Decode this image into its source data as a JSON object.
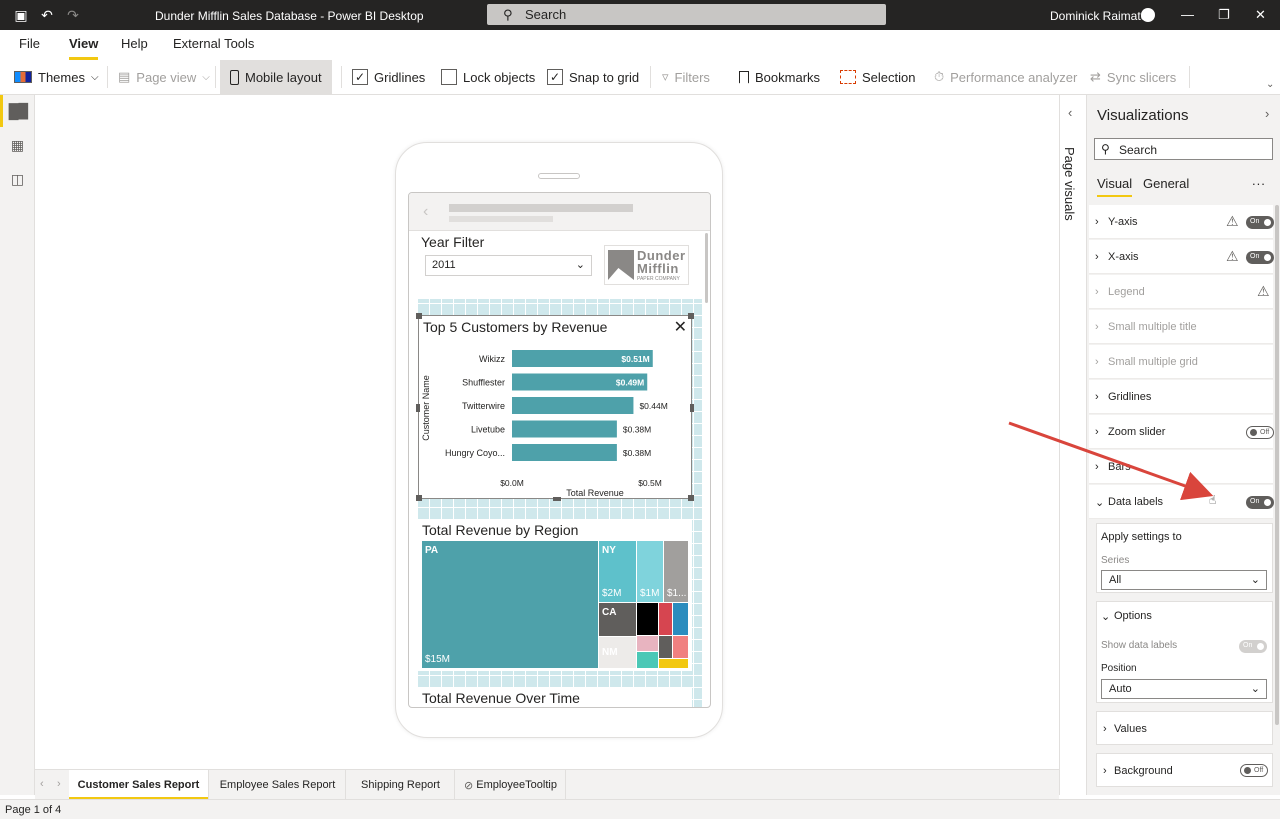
{
  "window": {
    "title": "Dunder Mifflin Sales Database - Power BI Desktop",
    "search_placeholder": "Search",
    "user": "Dominick Raimato"
  },
  "menu": [
    "File",
    "View",
    "Help",
    "External Tools"
  ],
  "ribbon": {
    "themes": "Themes",
    "page_view": "Page view",
    "mobile_layout": "Mobile layout",
    "gridlines": "Gridlines",
    "lock_objects": "Lock objects",
    "snap_to_grid": "Snap to grid",
    "filters": "Filters",
    "bookmarks": "Bookmarks",
    "selection": "Selection",
    "performance_analyzer": "Performance analyzer",
    "sync_slicers": "Sync slicers"
  },
  "mobile": {
    "year_filter": {
      "title": "Year Filter",
      "value": "2011"
    },
    "logo": {
      "line1": "Dunder",
      "line2": "Mifflin",
      "line3": "PAPER COMPANY"
    },
    "bar_chart": {
      "title": "Top 5 Customers by Revenue",
      "ylabel": "Customer Name",
      "xlabel": "Total Revenue",
      "ticks": [
        "$0.0M",
        "$0.5M"
      ]
    },
    "treemap": {
      "title": "Total Revenue by Region",
      "cells": [
        {
          "label": "PA",
          "value": "$15M"
        },
        {
          "label": "NY",
          "value": "$2M"
        },
        {
          "label": "",
          "value": "$1M"
        },
        {
          "label": "",
          "value": "$1..."
        },
        {
          "label": "CA",
          "value": ""
        },
        {
          "label": "NM",
          "value": ""
        }
      ]
    },
    "line_chart": {
      "title": "Total Revenue Over Time"
    }
  },
  "chart_data": {
    "type": "bar",
    "title": "Top 5 Customers by Revenue",
    "categories": [
      "Wikizz",
      "Shufflester",
      "Twitterwire",
      "Livetube",
      "Hungry Coyo..."
    ],
    "values": [
      0.51,
      0.49,
      0.44,
      0.38,
      0.38
    ],
    "labels": [
      "$0.51M",
      "$0.49M",
      "$0.44M",
      "$0.38M",
      "$0.38M"
    ],
    "xlabel": "Total Revenue",
    "ylabel": "Customer Name",
    "xlim": [
      0,
      0.5
    ],
    "color": "#4ea1aa"
  },
  "page_visuals_label": "Page visuals",
  "visualizations": {
    "title": "Visualizations",
    "search_placeholder": "Search",
    "tabs": [
      "Visual",
      "General"
    ],
    "more": "...",
    "sections": [
      {
        "label": "Y-axis",
        "warn": true,
        "toggle": "On"
      },
      {
        "label": "X-axis",
        "warn": true,
        "toggle": "On"
      },
      {
        "label": "Legend",
        "warn": true,
        "toggle": "",
        "disabled": true
      },
      {
        "label": "Small multiple title",
        "disabled": true
      },
      {
        "label": "Small multiple grid",
        "disabled": true
      },
      {
        "label": "Gridlines"
      },
      {
        "label": "Zoom slider",
        "toggle": "Off"
      },
      {
        "label": "Bars"
      },
      {
        "label": "Data labels",
        "toggle": "On"
      }
    ],
    "apply": {
      "title": "Apply settings to",
      "series_label": "Series",
      "series_value": "All"
    },
    "options": {
      "title": "Options",
      "show_label": "Show data labels",
      "show_toggle": "On",
      "position_label": "Position",
      "position_value": "Auto"
    },
    "values": "Values",
    "background": {
      "label": "Background",
      "toggle": "Off"
    }
  },
  "page_tabs": [
    "Customer Sales Report",
    "Employee Sales Report",
    "Shipping Report",
    "EmployeeTooltip"
  ],
  "status": "Page 1 of 4",
  "colors": {
    "accent": "#f2c811",
    "bar": "#4ea1aa",
    "arrow": "#d9453c"
  }
}
